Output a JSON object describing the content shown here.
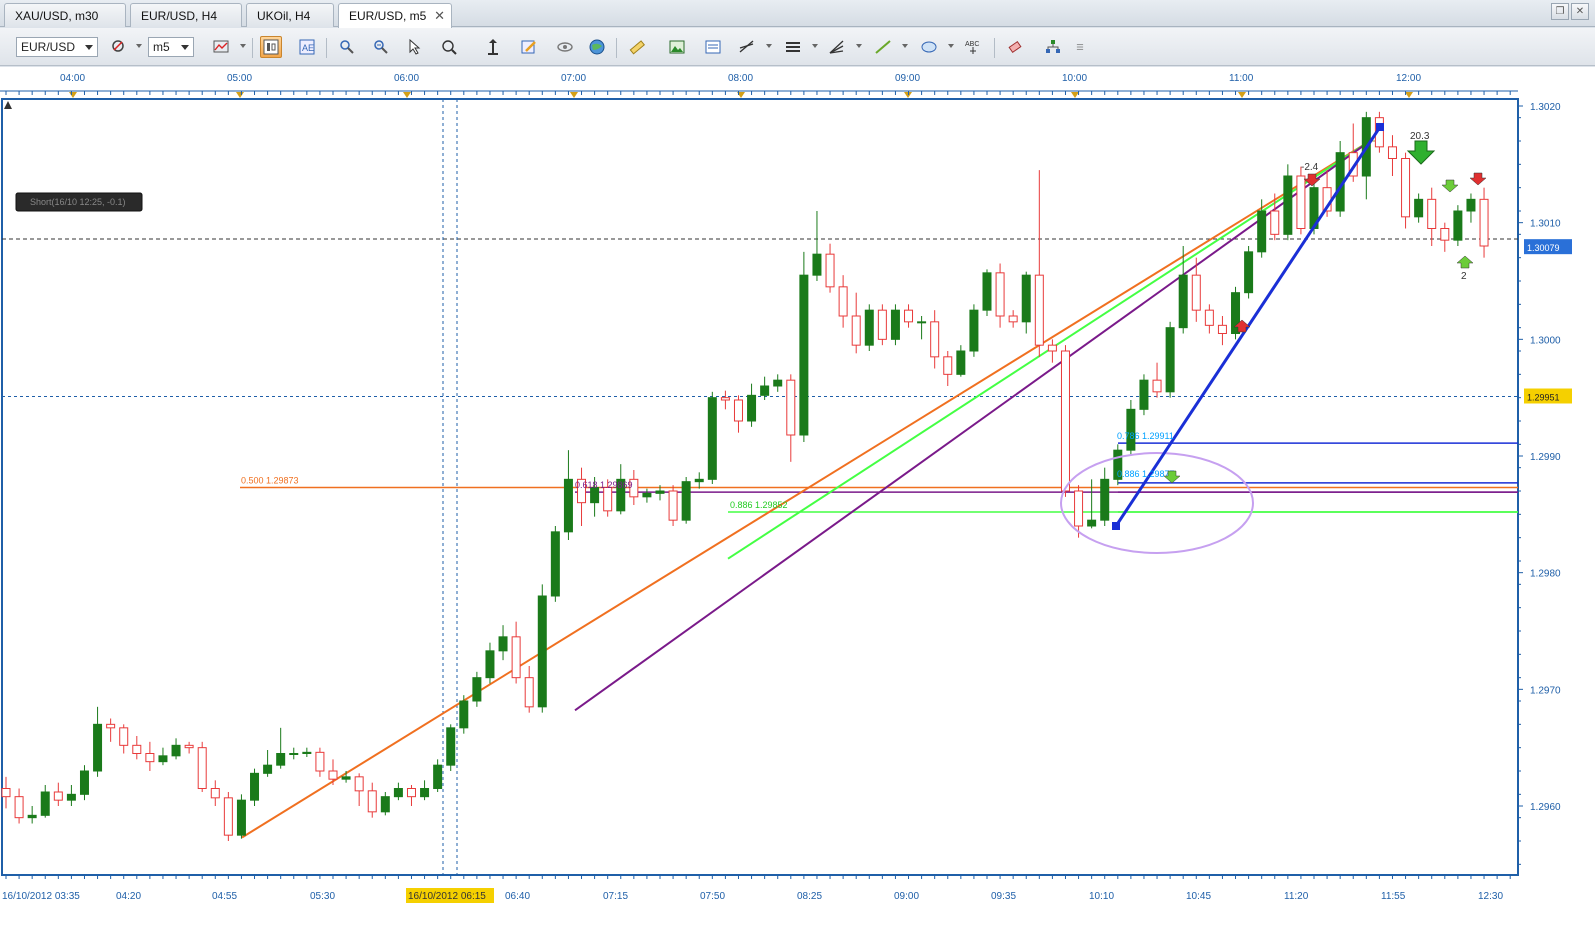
{
  "tabs": [
    {
      "label": "XAU/USD, m30",
      "active": false
    },
    {
      "label": "EUR/USD, H4",
      "active": false
    },
    {
      "label": "UKOil, H4",
      "active": false
    },
    {
      "label": "EUR/USD, m5",
      "active": true
    }
  ],
  "toolbar": {
    "instrument": "EUR/USD",
    "timeframe": "m5",
    "icons": [
      "chart-type-icon",
      "indicator-icon",
      "candle-style-icon",
      "toggle-grid-icon",
      "refresh-icon",
      "crosshair-icon",
      "pointer-icon",
      "zoom-icon",
      "scale-icon",
      "edit-icon",
      "magnifier-icon",
      "globe-icon",
      "ruler-icon",
      "picture-icon",
      "template-icon",
      "draw-lines-icon",
      "horizontal-lines-icon",
      "fibonacci-icon",
      "trendline-icon",
      "ellipse-icon",
      "text-icon",
      "eraser-icon",
      "objects-icon",
      "more-icon"
    ]
  },
  "chart": {
    "instrument": "EUR/USD",
    "period": "m5",
    "colors": {
      "bull": "#1a7a1a",
      "bear": "#e83a3a",
      "axis": "#1f5fa8",
      "orange": "#f07020",
      "green": "#44ff44",
      "purple": "#7a1a8a",
      "blue": "#1a2fd6",
      "lightblue": "#00a0ff",
      "ellipse": "#c6a0f0"
    },
    "top_time_labels": [
      "04:00",
      "05:00",
      "06:00",
      "07:00",
      "08:00",
      "09:00",
      "10:00",
      "11:00",
      "12:00"
    ],
    "bottom_time_labels": [
      "16/10/2012 03:35",
      "04:20",
      "04:55",
      "05:30",
      "16/10/2012 06:15",
      "06:40",
      "07:15",
      "07:50",
      "08:25",
      "09:00",
      "09:35",
      "10:10",
      "10:45",
      "11:20",
      "11:55",
      "12:30"
    ],
    "highlighted_time_label": "16/10/2012 06:15",
    "price_labels": [
      "1.3020",
      "1.3010",
      "1.3000",
      "1.2990",
      "1.2980",
      "1.2970",
      "1.2960"
    ],
    "current_price": "1.30079",
    "line_price": "1.29951",
    "order_label": "Short(16/10 12:25, -0.1)",
    "fib_levels": [
      {
        "label": "0.500 1.29873",
        "color": "#f07020"
      },
      {
        "label": "0.618 1.29869",
        "color": "#7a1a8a"
      },
      {
        "label": "0.886 1.29852",
        "color": "#22cc22"
      },
      {
        "label": "0.786 1.29911",
        "color": "#00a0ff"
      },
      {
        "label": "0.886 1.29877",
        "color": "#00a0ff"
      }
    ],
    "annotations": [
      "20.3",
      "-2.4",
      "2"
    ],
    "candles": [
      [
        1.29615,
        1.29608,
        1.29625,
        1.29598
      ],
      [
        1.29608,
        1.2959,
        1.29615,
        1.29585
      ],
      [
        1.2959,
        1.29592,
        1.296,
        1.29585
      ],
      [
        1.29592,
        1.29612,
        1.29618,
        1.2959
      ],
      [
        1.29612,
        1.29605,
        1.2962,
        1.296
      ],
      [
        1.29605,
        1.2961,
        1.29618,
        1.296
      ],
      [
        1.2961,
        1.2963,
        1.29635,
        1.29605
      ],
      [
        1.2963,
        1.2967,
        1.29685,
        1.29625
      ],
      [
        1.2967,
        1.29667,
        1.29675,
        1.29655
      ],
      [
        1.29667,
        1.29652,
        1.2967,
        1.29645
      ],
      [
        1.29652,
        1.29645,
        1.2966,
        1.2964
      ],
      [
        1.29645,
        1.29638,
        1.29655,
        1.2963
      ],
      [
        1.29638,
        1.29643,
        1.2965,
        1.29635
      ],
      [
        1.29643,
        1.29652,
        1.29658,
        1.2964
      ],
      [
        1.29652,
        1.2965,
        1.29655,
        1.29645
      ],
      [
        1.2965,
        1.29615,
        1.29655,
        1.29612
      ],
      [
        1.29615,
        1.29607,
        1.29622,
        1.296
      ],
      [
        1.29607,
        1.29575,
        1.29612,
        1.2957
      ],
      [
        1.29575,
        1.29605,
        1.2961,
        1.29572
      ],
      [
        1.29605,
        1.29628,
        1.29632,
        1.296
      ],
      [
        1.29628,
        1.29635,
        1.29648,
        1.29625
      ],
      [
        1.29635,
        1.29645,
        1.29667,
        1.29632
      ],
      [
        1.29645,
        1.29645,
        1.2965,
        1.2964
      ],
      [
        1.29645,
        1.29646,
        1.2965,
        1.29642
      ],
      [
        1.29646,
        1.2963,
        1.2965,
        1.29625
      ],
      [
        1.2963,
        1.29623,
        1.2964,
        1.29618
      ],
      [
        1.29623,
        1.29625,
        1.2963,
        1.2962
      ],
      [
        1.29625,
        1.29613,
        1.29628,
        1.296
      ],
      [
        1.29613,
        1.29595,
        1.2962,
        1.2959
      ],
      [
        1.29595,
        1.29608,
        1.29612,
        1.29592
      ],
      [
        1.29608,
        1.29615,
        1.2962,
        1.29605
      ],
      [
        1.29615,
        1.29608,
        1.29618,
        1.296
      ],
      [
        1.29608,
        1.29615,
        1.29622,
        1.29605
      ],
      [
        1.29615,
        1.29635,
        1.2964,
        1.29612
      ],
      [
        1.29635,
        1.29667,
        1.2967,
        1.2963
      ],
      [
        1.29667,
        1.2969,
        1.29695,
        1.29662
      ],
      [
        1.2969,
        1.2971,
        1.29715,
        1.29685
      ],
      [
        1.2971,
        1.29733,
        1.2974,
        1.29705
      ],
      [
        1.29733,
        1.29745,
        1.29755,
        1.29725
      ],
      [
        1.29745,
        1.2971,
        1.29758,
        1.29705
      ],
      [
        1.2971,
        1.29685,
        1.2972,
        1.2968
      ],
      [
        1.29685,
        1.2978,
        1.2979,
        1.2968
      ],
      [
        1.2978,
        1.29835,
        1.2984,
        1.29775
      ],
      [
        1.29835,
        1.2988,
        1.29905,
        1.29828
      ],
      [
        1.2988,
        1.2986,
        1.2989,
        1.2984
      ],
      [
        1.2986,
        1.29873,
        1.29882,
        1.29848
      ],
      [
        1.29873,
        1.29853,
        1.2988,
        1.29848
      ],
      [
        1.29853,
        1.2988,
        1.29893,
        1.2985
      ],
      [
        1.2988,
        1.29865,
        1.29888,
        1.29858
      ],
      [
        1.29865,
        1.29868,
        1.29872,
        1.2986
      ],
      [
        1.29868,
        1.2987,
        1.29875,
        1.29862
      ],
      [
        1.2987,
        1.29845,
        1.29875,
        1.2984
      ],
      [
        1.29845,
        1.29878,
        1.29882,
        1.29842
      ],
      [
        1.29878,
        1.2988,
        1.29886,
        1.29872
      ],
      [
        1.2988,
        1.2995,
        1.29955,
        1.29876
      ],
      [
        1.2995,
        1.29948,
        1.29956,
        1.2994
      ],
      [
        1.29948,
        1.2993,
        1.29952,
        1.2992
      ],
      [
        1.2993,
        1.29952,
        1.29962,
        1.29925
      ],
      [
        1.29952,
        1.2996,
        1.29968,
        1.29948
      ],
      [
        1.2996,
        1.29965,
        1.2997,
        1.29955
      ],
      [
        1.29965,
        1.29918,
        1.2997,
        1.29895
      ],
      [
        1.29918,
        1.30055,
        1.30075,
        1.29912
      ],
      [
        1.30055,
        1.30073,
        1.3011,
        1.3005
      ],
      [
        1.30073,
        1.30045,
        1.30082,
        1.3004
      ],
      [
        1.30045,
        1.3002,
        1.30055,
        1.3001
      ],
      [
        1.3002,
        1.29995,
        1.3004,
        1.29988
      ],
      [
        1.29995,
        1.30025,
        1.3003,
        1.2999
      ],
      [
        1.30025,
        1.3,
        1.3003,
        1.29995
      ],
      [
        1.3,
        1.30025,
        1.3003,
        1.29995
      ],
      [
        1.30025,
        1.30015,
        1.3003,
        1.3001
      ],
      [
        1.30015,
        1.30015,
        1.3002,
        1.3
      ],
      [
        1.30015,
        1.29985,
        1.30025,
        1.29975
      ],
      [
        1.29985,
        1.2997,
        1.2999,
        1.2996
      ],
      [
        1.2997,
        1.2999,
        1.29995,
        1.29968
      ],
      [
        1.2999,
        1.30025,
        1.3003,
        1.29985
      ],
      [
        1.30025,
        1.30057,
        1.3006,
        1.3002
      ],
      [
        1.30057,
        1.3002,
        1.30065,
        1.3001
      ],
      [
        1.3002,
        1.30015,
        1.30025,
        1.3001
      ],
      [
        1.30015,
        1.30055,
        1.30058,
        1.30005
      ],
      [
        1.30055,
        1.29995,
        1.30145,
        1.29985
      ],
      [
        1.29995,
        1.2999,
        1.3,
        1.2998
      ],
      [
        1.2999,
        1.2987,
        1.29995,
        1.29865
      ],
      [
        1.2987,
        1.2984,
        1.29875,
        1.2983
      ],
      [
        1.2984,
        1.29845,
        1.2988,
        1.29838
      ],
      [
        1.29845,
        1.2988,
        1.2989,
        1.2984
      ],
      [
        1.2988,
        1.29905,
        1.2991,
        1.29875
      ],
      [
        1.29905,
        1.2994,
        1.29948,
        1.299
      ],
      [
        1.2994,
        1.29965,
        1.2997,
        1.29935
      ],
      [
        1.29965,
        1.29955,
        1.2998,
        1.2995
      ],
      [
        1.29955,
        1.3001,
        1.30015,
        1.2995
      ],
      [
        1.3001,
        1.30055,
        1.3008,
        1.30005
      ],
      [
        1.30055,
        1.30025,
        1.3007,
        1.30015
      ],
      [
        1.30025,
        1.30012,
        1.3003,
        1.30005
      ],
      [
        1.30012,
        1.30005,
        1.3002,
        1.29995
      ],
      [
        1.30005,
        1.3004,
        1.30045,
        1.3
      ],
      [
        1.3004,
        1.30075,
        1.3008,
        1.30035
      ],
      [
        1.30075,
        1.3011,
        1.3012,
        1.3007
      ],
      [
        1.3011,
        1.3009,
        1.30125,
        1.30085
      ],
      [
        1.3009,
        1.3014,
        1.3015,
        1.30085
      ],
      [
        1.3014,
        1.30095,
        1.30148,
        1.3009
      ],
      [
        1.30095,
        1.3013,
        1.30135,
        1.3009
      ],
      [
        1.3013,
        1.3011,
        1.30145,
        1.30105
      ],
      [
        1.3011,
        1.3016,
        1.3017,
        1.30105
      ],
      [
        1.3016,
        1.3014,
        1.30185,
        1.30135
      ],
      [
        1.3014,
        1.3019,
        1.30195,
        1.3012
      ],
      [
        1.3019,
        1.30165,
        1.30195,
        1.3016
      ],
      [
        1.30165,
        1.30155,
        1.30175,
        1.3014
      ],
      [
        1.30155,
        1.30105,
        1.3016,
        1.30095
      ],
      [
        1.30105,
        1.3012,
        1.30125,
        1.301
      ],
      [
        1.3012,
        1.30095,
        1.3013,
        1.3008
      ],
      [
        1.30095,
        1.30085,
        1.301,
        1.30075
      ],
      [
        1.30085,
        1.3011,
        1.30115,
        1.3008
      ],
      [
        1.3011,
        1.3012,
        1.30125,
        1.301
      ],
      [
        1.3012,
        1.3008,
        1.3013,
        1.3007
      ]
    ]
  }
}
